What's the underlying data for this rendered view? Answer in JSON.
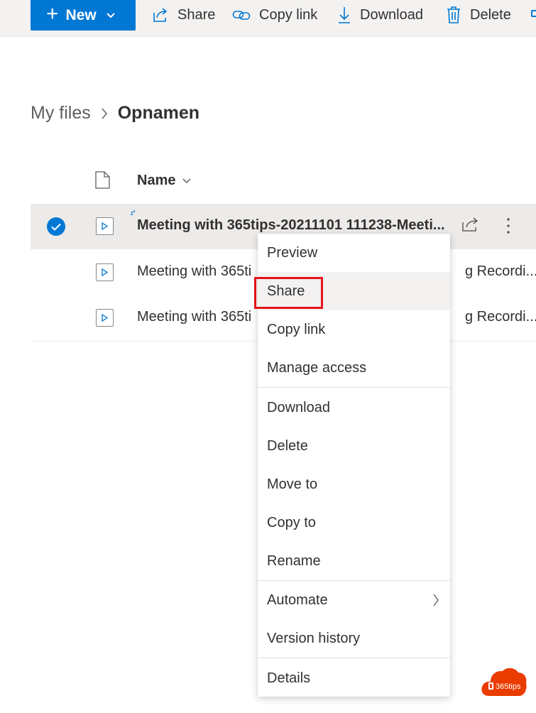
{
  "toolbar": {
    "new_label": "New",
    "share_label": "Share",
    "copy_link_label": "Copy link",
    "download_label": "Download",
    "delete_label": "Delete"
  },
  "breadcrumb": {
    "root": "My files",
    "current": "Opnamen"
  },
  "list": {
    "name_header": "Name",
    "rows": [
      {
        "name": "Meeting with 365tips-20211101 111238-Meeti...",
        "selected": true
      },
      {
        "name_left": "Meeting with 365ti",
        "name_right": "g Recordi..."
      },
      {
        "name_left": "Meeting with 365ti",
        "name_right": "g Recordi..."
      }
    ]
  },
  "context_menu": {
    "items": [
      "Preview",
      "Share",
      "Copy link",
      "Manage access",
      "Download",
      "Delete",
      "Move to",
      "Copy to",
      "Rename",
      "Automate",
      "Version history",
      "Details"
    ]
  },
  "watermark": {
    "text": "365tips"
  },
  "colors": {
    "accent": "#0078d4",
    "highlight": "#e3141b",
    "logo": "#eb3c00"
  }
}
